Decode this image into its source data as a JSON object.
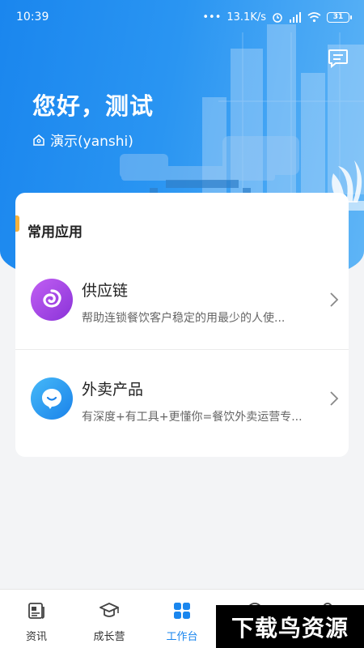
{
  "status_bar": {
    "time": "10:39",
    "network_speed": "13.1K/s",
    "battery": "31"
  },
  "header": {
    "greeting": "您好，测试",
    "org_name": "演示(yanshi)",
    "message_icon": "message-icon",
    "org_icon": "home-icon"
  },
  "common_apps": {
    "title": "常用应用",
    "items": [
      {
        "name": "供应链",
        "description": "帮助连锁餐饮客户稳定的用最少的人使...",
        "icon": "supply-chain-icon",
        "color": "#a84be6"
      },
      {
        "name": "外卖产品",
        "description": "有深度+有工具+更懂你=餐饮外卖运营专...",
        "icon": "takeaway-icon",
        "color": "#2a9af0"
      }
    ]
  },
  "tabbar": {
    "tabs": [
      {
        "label": "资讯",
        "icon": "news-icon"
      },
      {
        "label": "成长营",
        "icon": "graduation-cap-icon"
      },
      {
        "label": "工作台",
        "icon": "grid-icon",
        "active": true
      },
      {
        "label": "",
        "icon": "compass-icon"
      },
      {
        "label": "",
        "icon": "person-icon"
      }
    ]
  },
  "watermark": "下载鸟资源",
  "colors": {
    "accent": "#1a86ee",
    "section_marker": "#f6b13c",
    "background": "#f3f4f6"
  }
}
